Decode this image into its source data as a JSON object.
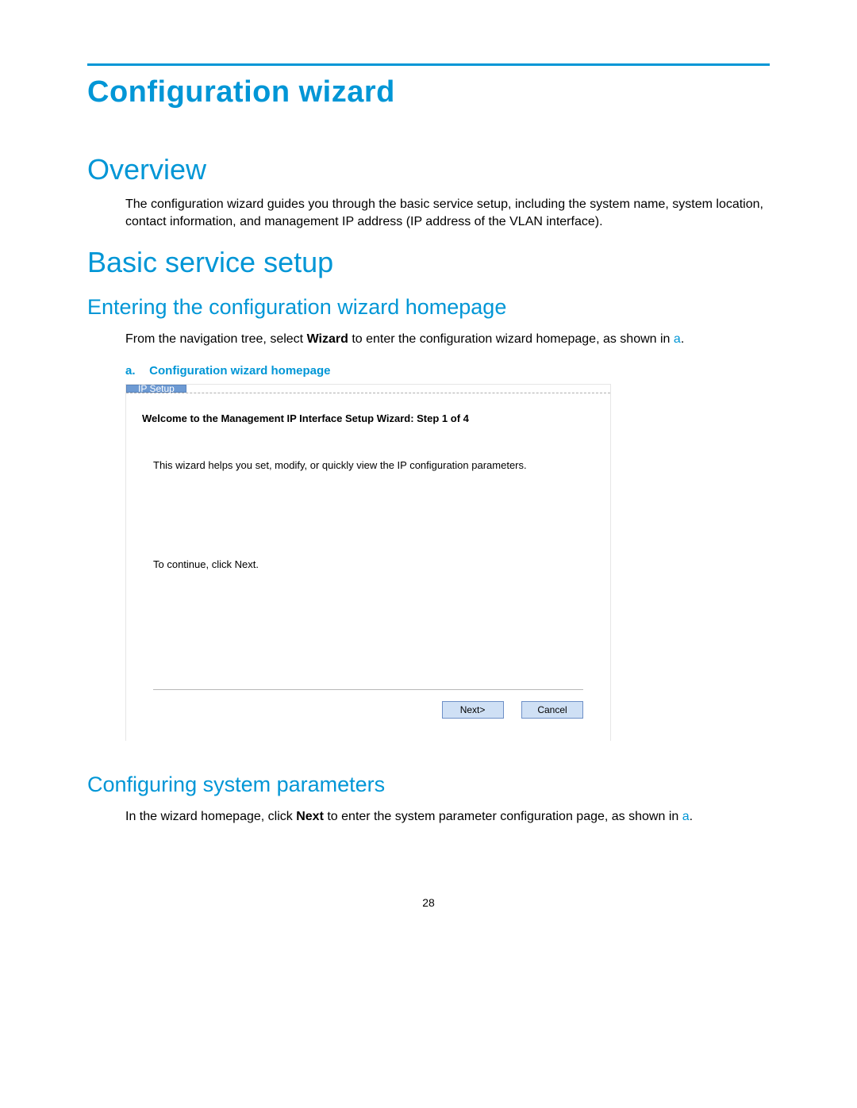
{
  "page": {
    "title": "Configuration wizard",
    "number": "28"
  },
  "overview": {
    "heading": "Overview",
    "text": "The configuration wizard guides you through the basic service setup, including the system name, system location, contact information, and management IP address (IP address of the VLAN interface)."
  },
  "basic": {
    "heading": "Basic service setup"
  },
  "entering": {
    "heading": "Entering the configuration wizard homepage",
    "para_pre": "From the navigation tree, select ",
    "para_bold": "Wizard",
    "para_mid": " to enter the configuration wizard homepage, as shown in ",
    "para_link": "a",
    "para_post": "."
  },
  "figure": {
    "label_letter": "a.",
    "label_text": "Configuration wizard homepage"
  },
  "wizard": {
    "tab": "IP Setup",
    "welcome": "Welcome to the Management IP Interface Setup Wizard:  Step 1 of 4",
    "desc": "This wizard helps you set, modify, or quickly view the IP configuration parameters.",
    "continue": "To continue, click Next.",
    "next_btn": "Next>",
    "cancel_btn": "Cancel"
  },
  "configuring": {
    "heading": "Configuring system parameters",
    "para_pre": "In the wizard homepage, click ",
    "para_bold": "Next",
    "para_mid": " to enter the system parameter configuration page, as shown in ",
    "para_link": "a",
    "para_post": "."
  }
}
